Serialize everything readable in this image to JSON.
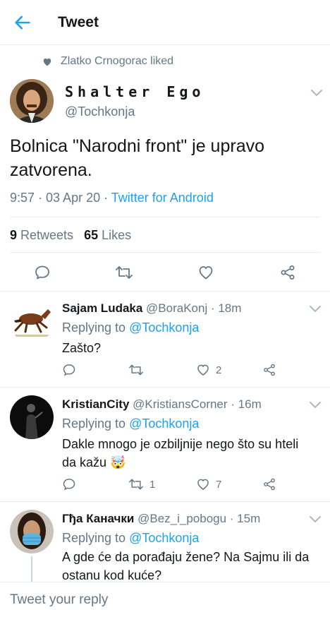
{
  "header": {
    "title": "Tweet"
  },
  "social_context": "Zlatko Crnogorac liked",
  "tweet": {
    "display_name": "Shalter Ego",
    "handle": "@Tochkonja",
    "text": "Bolnica \"Narodni front\" je upravo zatvorena.",
    "time_date": "9:57 · 03 Apr 20 · ",
    "source": "Twitter for Android",
    "retweets_count": "9",
    "retweets_label": " Retweets",
    "likes_count": "65",
    "likes_label": " Likes"
  },
  "replies": [
    {
      "name": "Sajam Ludaka",
      "meta": " @BoraKonj · 18m",
      "replying_prefix": "Replying to ",
      "replying_to": "@Tochkonja",
      "text": "Zašto?",
      "retweets": "",
      "likes": "2"
    },
    {
      "name": "KristianCity",
      "meta": " @KristiansCorner · 16m",
      "replying_prefix": "Replying to ",
      "replying_to": "@Tochkonja",
      "text": "Dakle mnogo je ozbiljnije nego što su hteli da kažu 🤯",
      "retweets": "1",
      "likes": "7"
    },
    {
      "name": "Гђа Каначки",
      "meta": " @Bez_i_pobogu · 15m",
      "replying_prefix": "Replying to ",
      "replying_to": "@Tochkonja",
      "text": "A gde će da porađaju žene? Na Sajmu ili da ostanu kod kuće?"
    }
  ],
  "compose": {
    "placeholder": "Tweet your reply"
  },
  "colors": {
    "accent": "#1da1f2",
    "secondary_text": "#657786",
    "divider": "#e6ecf0"
  }
}
